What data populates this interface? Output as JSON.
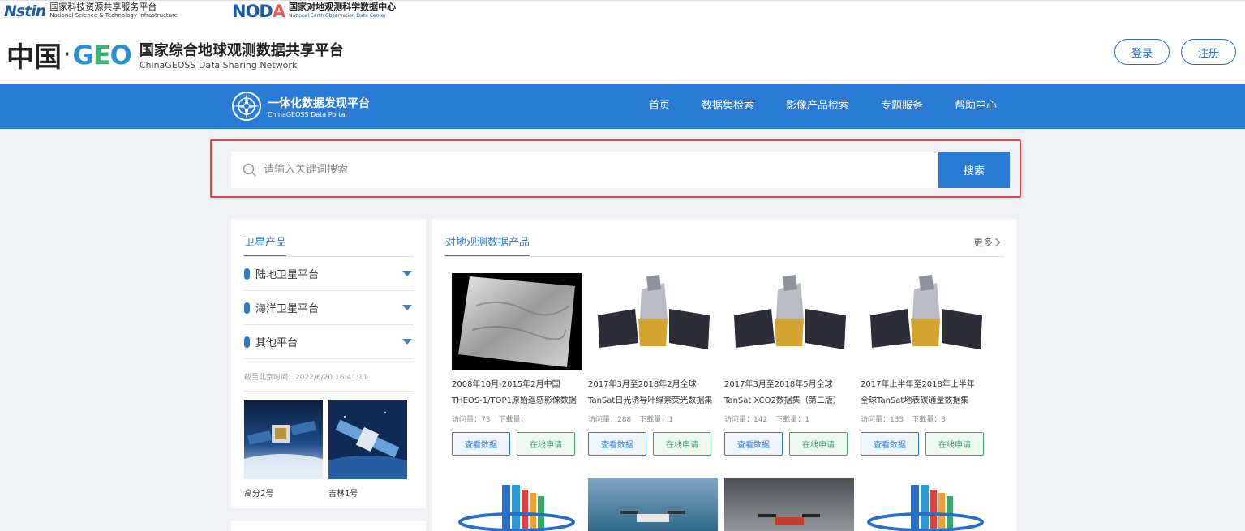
{
  "partners": {
    "nstin": {
      "mark": "Nstin",
      "name_cn": "国家科技资源共享服务平台",
      "name_en": "National Science & Technology Infrastructure"
    },
    "noda": {
      "mark_main": "NOD",
      "mark_accent": "A",
      "name_cn": "国家对地观测科学数据中心",
      "name_en": "National Earth Observation Data Center"
    }
  },
  "brand": {
    "zhongguo": "中国",
    "dot": "·",
    "geo_g": "G",
    "geo_e": "E",
    "geo_o": "O",
    "title_cn": "国家综合地球观测数据共享平台",
    "title_en": "ChinaGEOSS Data Sharing Network"
  },
  "auth": {
    "login": "登录",
    "register": "注册"
  },
  "nav": {
    "portal_cn": "一体化数据发现平台",
    "portal_en": "ChinaGEOSS Data Portal",
    "items": [
      "首页",
      "数据集检索",
      "影像产品检索",
      "专题服务",
      "帮助中心"
    ]
  },
  "search": {
    "placeholder": "请输入关键词搜索",
    "value": "",
    "button": "搜索"
  },
  "sidebar": {
    "tab": "卫星产品",
    "items": [
      "陆地卫星平台",
      "海洋卫星平台",
      "其他平台"
    ],
    "time": "截至北京时间：2022/6/20 16:41:11",
    "thumbs": [
      {
        "caption": "高分2号"
      },
      {
        "caption": "吉林1号"
      }
    ]
  },
  "main": {
    "tab": "对地观测数据产品",
    "more": "更多",
    "stat_visit": "访问量：",
    "stat_download": "下载量：",
    "btn_view": "查看数据",
    "btn_apply": "在线申请",
    "cards": [
      {
        "title1": "2008年10月-2015年2月中国",
        "title2": "THEOS-1/TOP1原始遥感影像数据",
        "visits": "73",
        "downloads": "",
        "image": "sar-image"
      },
      {
        "title1": "2017年3月至2018年2月全球",
        "title2": "TanSat日光诱导叶绿素荧光数据集",
        "visits": "288",
        "downloads": "1",
        "image": "satellite"
      },
      {
        "title1": "2017年3月至2018年5月全球",
        "title2": "TanSat XCO2数据集（第二版）",
        "visits": "142",
        "downloads": "1",
        "image": "satellite"
      },
      {
        "title1": "2017年上半年至2018年上半年",
        "title2": "全球TanSat地表碳通量数据集",
        "visits": "133",
        "downloads": "3",
        "image": "satellite"
      }
    ]
  },
  "colors": {
    "nav_blue": "#2a7bd5",
    "accent_green": "#36a86c",
    "highlight_red": "#e53e3e"
  }
}
